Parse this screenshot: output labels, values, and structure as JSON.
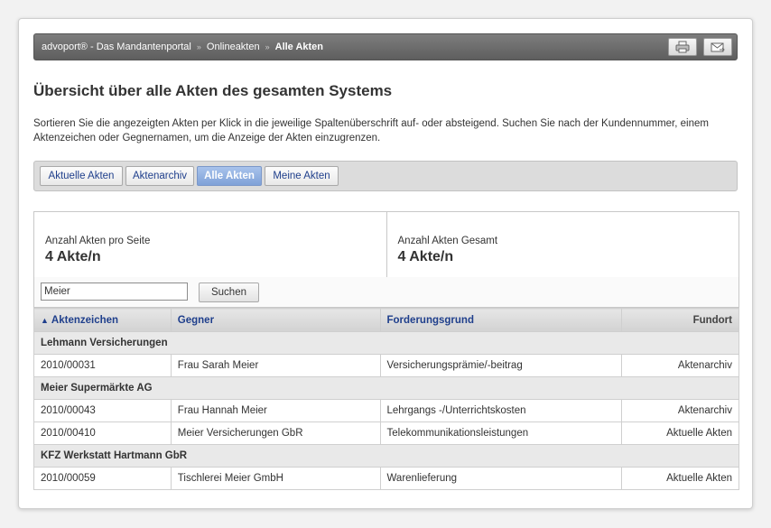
{
  "breadcrumb": {
    "items": [
      "advoport® - Das Mandantenportal",
      "Onlineakten"
    ],
    "current": "Alle Akten",
    "separator": "»"
  },
  "toolbar": {
    "print_icon": "printer-icon",
    "mail_icon": "mail-icon"
  },
  "page": {
    "title": "Übersicht über alle Akten des gesamten Systems",
    "intro": "Sortieren Sie die angezeigten Akten per Klick in die jeweilige Spaltenüberschrift auf- oder absteigend. Suchen Sie nach der Kundennummer, einem Aktenzeichen oder Gegnernamen, um die Anzeige der Akten einzugrenzen."
  },
  "tabs": [
    {
      "label": "Aktuelle Akten",
      "active": false
    },
    {
      "label": "Aktenarchiv",
      "active": false
    },
    {
      "label": "Alle Akten",
      "active": true
    },
    {
      "label": "Meine Akten",
      "active": false
    }
  ],
  "stats": {
    "per_page_label": "Anzahl Akten pro Seite",
    "per_page_value": "4 Akte/n",
    "total_label": "Anzahl Akten Gesamt",
    "total_value": "4 Akte/n"
  },
  "search": {
    "value": "Meier",
    "button_label": "Suchen"
  },
  "table": {
    "sort_indicator": "▲",
    "columns": [
      "Aktenzeichen",
      "Gegner",
      "Forderungsgrund",
      "Fundort"
    ],
    "groups": [
      {
        "name": "Lehmann Versicherungen",
        "rows": [
          [
            "2010/00031",
            "Frau Sarah Meier",
            "Versicherungsprämie/-beitrag",
            "Aktenarchiv"
          ]
        ]
      },
      {
        "name": "Meier Supermärkte AG",
        "rows": [
          [
            "2010/00043",
            "Frau Hannah Meier",
            "Lehrgangs -/Unterrichtskosten",
            "Aktenarchiv"
          ],
          [
            "2010/00410",
            "Meier Versicherungen GbR",
            "Telekommunikationsleistungen",
            "Aktuelle Akten"
          ]
        ]
      },
      {
        "name": "KFZ Werkstatt Hartmann GbR",
        "rows": [
          [
            "2010/00059",
            "Tischlerei Meier GmbH",
            "Warenlieferung",
            "Aktuelle Akten"
          ]
        ]
      }
    ]
  }
}
